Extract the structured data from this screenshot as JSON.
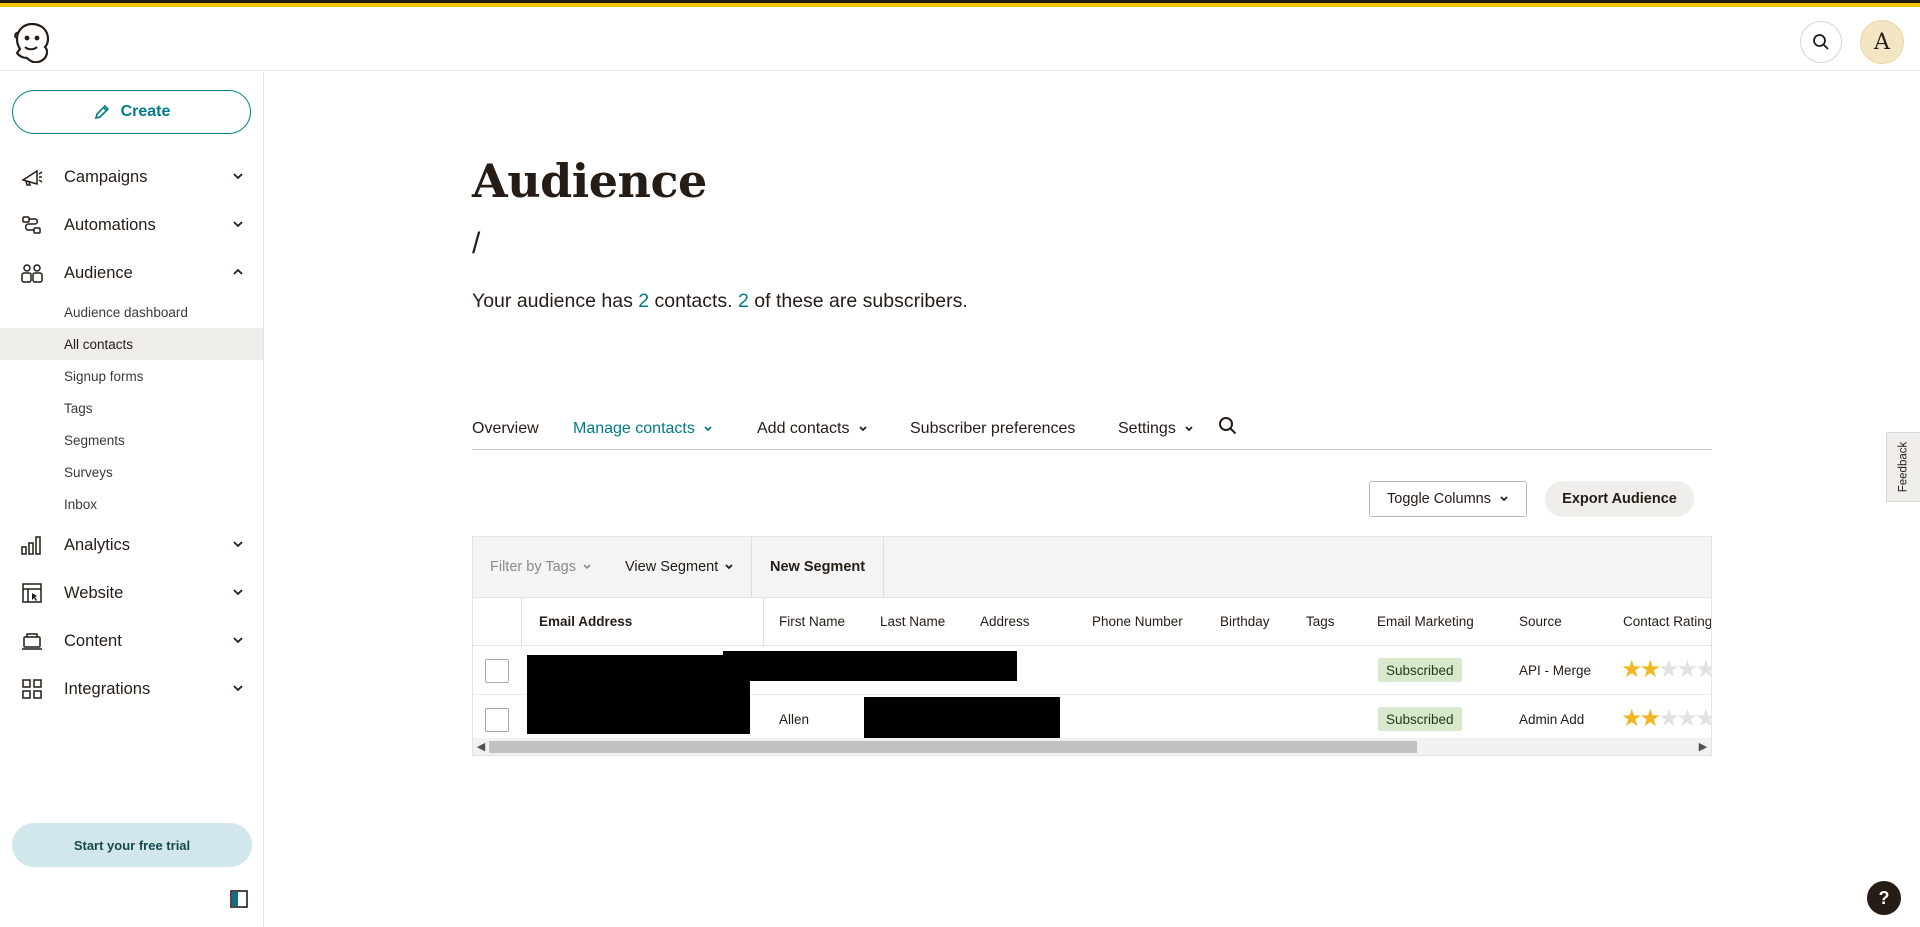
{
  "header": {
    "logo_icon": "freddie-monkey-logo",
    "avatar_letter": "A",
    "search_icon": "search-icon"
  },
  "sidebar": {
    "create_label": "Create",
    "items": [
      {
        "label": "Campaigns",
        "icon": "megaphone-icon",
        "expanded": false
      },
      {
        "label": "Automations",
        "icon": "flow-icon",
        "expanded": false
      },
      {
        "label": "Audience",
        "icon": "audience-icon",
        "expanded": true
      },
      {
        "label": "Analytics",
        "icon": "bar-chart-icon",
        "expanded": false
      },
      {
        "label": "Website",
        "icon": "website-icon",
        "expanded": false
      },
      {
        "label": "Content",
        "icon": "content-icon",
        "expanded": false
      },
      {
        "label": "Integrations",
        "icon": "grid-icon",
        "expanded": false
      }
    ],
    "audience_sub": [
      {
        "label": "Audience dashboard",
        "active": false
      },
      {
        "label": "All contacts",
        "active": true
      },
      {
        "label": "Signup forms",
        "active": false
      },
      {
        "label": "Tags",
        "active": false
      },
      {
        "label": "Segments",
        "active": false
      },
      {
        "label": "Surveys",
        "active": false
      },
      {
        "label": "Inbox",
        "active": false
      }
    ],
    "trial_label": "Start your free trial"
  },
  "main": {
    "title": "Audience",
    "breadcrumb": "/",
    "summary": {
      "prefix": "Your audience has ",
      "contacts_count": "2",
      "middle": " contacts. ",
      "subscribers_count": "2",
      "suffix": " of these are subscribers."
    },
    "tabs": [
      {
        "label": "Overview",
        "dropdown": false,
        "active": false
      },
      {
        "label": "Manage contacts",
        "dropdown": true,
        "active": true
      },
      {
        "label": "Add contacts",
        "dropdown": true,
        "active": false
      },
      {
        "label": "Subscriber preferences",
        "dropdown": false,
        "active": false
      },
      {
        "label": "Settings",
        "dropdown": true,
        "active": false
      }
    ],
    "toggle_columns_label": "Toggle Columns",
    "export_label": "Export Audience",
    "filter_by_tags_label": "Filter by Tags",
    "view_segment_label": "View Segment",
    "new_segment_label": "New Segment",
    "table": {
      "columns": [
        "Email Address",
        "First Name",
        "Last Name",
        "Address",
        "Phone Number",
        "Birthday",
        "Tags",
        "Email Marketing",
        "Source",
        "Contact Rating"
      ],
      "rows": [
        {
          "first_name": "",
          "email_marketing": "Subscribed",
          "source": "API - Merge",
          "rating": 2
        },
        {
          "first_name": "Allen",
          "email_marketing": "Subscribed",
          "source": "Admin Add",
          "rating": 2
        }
      ]
    }
  },
  "feedback_label": "Feedback",
  "help_label": "?",
  "colors": {
    "accent": "#007c89",
    "brand_yellow": "#f5c400",
    "badge_green": "#d7e8cd",
    "star": "#f3b623"
  }
}
